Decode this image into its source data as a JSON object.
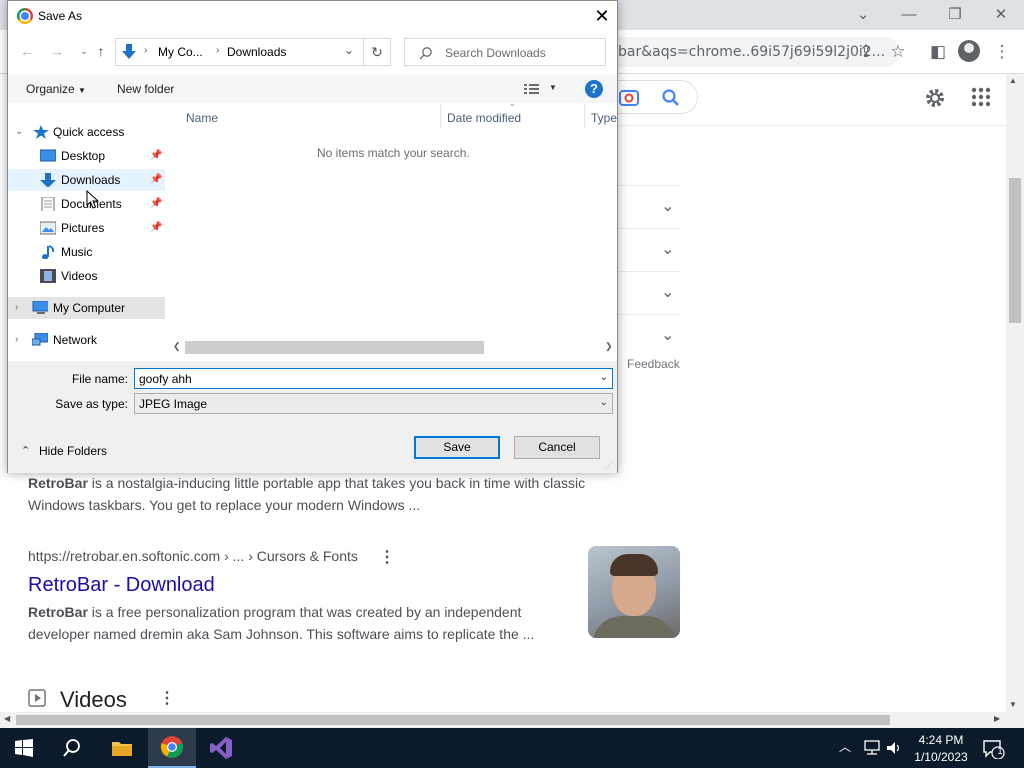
{
  "browser": {
    "omnibox_text": "bar&aqs=chrome..69i57j69i59l2j0i2...",
    "window_controls": {
      "minimize": "—",
      "restore": "❐",
      "close": "✕",
      "tab_search": "⌄"
    },
    "feedback_label": "Feedback"
  },
  "results": [
    {
      "snippet_bold": "RetroBar",
      "snippet_line1": " is a nostalgia-inducing little portable app that takes you back in time with classic",
      "snippet_line2": "Windows taskbars. You get to replace your modern Windows ..."
    },
    {
      "url": "https://retrobar.en.softonic.com › ... › Cursors & Fonts",
      "title": "RetroBar - Download",
      "snippet_bold": "RetroBar",
      "snippet_line1": " is a free personalization program that was created by an independent",
      "snippet_line2": "developer named dremin aka Sam Johnson. This software aims to replicate the ..."
    }
  ],
  "videos_heading": "Videos",
  "taskbar": {
    "time": "4:24 PM",
    "date": "1/10/2023",
    "notification_count": "1"
  },
  "dialog": {
    "title": "Save As",
    "breadcrumb": [
      "My Co...",
      "Downloads"
    ],
    "search_placeholder": "Search Downloads",
    "organize_label": "Organize",
    "new_folder_label": "New folder",
    "nav": {
      "quick_access": "Quick access",
      "quick_items": [
        {
          "label": "Desktop",
          "pinned": true
        },
        {
          "label": "Downloads",
          "pinned": true
        },
        {
          "label": "Documents",
          "pinned": true
        },
        {
          "label": "Pictures",
          "pinned": true
        },
        {
          "label": "Music",
          "pinned": false
        },
        {
          "label": "Videos",
          "pinned": false
        }
      ],
      "my_computer": "My Computer",
      "network": "Network"
    },
    "columns": [
      "Name",
      "Date modified",
      "Type"
    ],
    "empty_message": "No items match your search.",
    "file_name_label": "File name:",
    "file_name_value": "goofy ahh",
    "save_type_label": "Save as type:",
    "save_type_value": "JPEG Image",
    "hide_folders_label": "Hide Folders",
    "save_button": "Save",
    "cancel_button": "Cancel"
  }
}
